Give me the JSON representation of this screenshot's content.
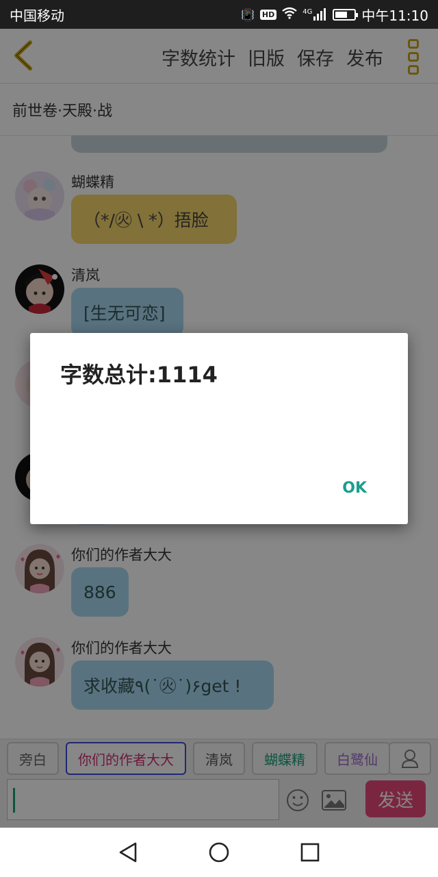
{
  "status_bar": {
    "carrier": "中国移动",
    "signal_label": "4G",
    "hd_label": "HD",
    "time": "中午11:10"
  },
  "header": {
    "actions": [
      "字数统计",
      "旧版",
      "保存",
      "发布"
    ]
  },
  "chapter_title": "前世卷·天殿·战",
  "messages": [
    {
      "sender": "蝴蝶精",
      "text": "（*/㊋ \\ *）捂脸",
      "bubble": "yellow"
    },
    {
      "sender": "清岚",
      "text": "[生无可恋]",
      "bubble": "blue"
    },
    {
      "sender": "你们的作者大大",
      "text": "886",
      "bubble": "blue"
    },
    {
      "sender": "你们的作者大大",
      "text": "求收藏٩(˙㊋˙)۶get !",
      "bubble": "blue"
    }
  ],
  "roles": [
    "旁白",
    "你们的作者大大",
    "清岚",
    "蝴蝶精",
    "白鹭仙"
  ],
  "composer": {
    "input_value": "",
    "send_label": "发送"
  },
  "dialog": {
    "message": "字数总计:1114",
    "ok_label": "OK"
  },
  "colors": {
    "accent_send": "#e9487a",
    "dialog_button": "#1a9e8e",
    "menu_icon": "#c9a515"
  }
}
